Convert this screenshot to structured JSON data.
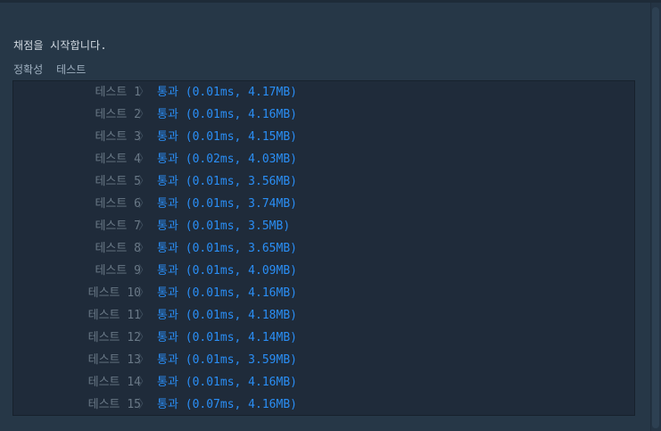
{
  "header_message": "채점을 시작합니다.",
  "section": {
    "accuracy_label": "정확성",
    "test_label": "테스트"
  },
  "tests": [
    {
      "label": "테스트 1",
      "result": "통과 (0.01ms, 4.17MB)"
    },
    {
      "label": "테스트 2",
      "result": "통과 (0.01ms, 4.16MB)"
    },
    {
      "label": "테스트 3",
      "result": "통과 (0.01ms, 4.15MB)"
    },
    {
      "label": "테스트 4",
      "result": "통과 (0.02ms, 4.03MB)"
    },
    {
      "label": "테스트 5",
      "result": "통과 (0.01ms, 3.56MB)"
    },
    {
      "label": "테스트 6",
      "result": "통과 (0.01ms, 3.74MB)"
    },
    {
      "label": "테스트 7",
      "result": "통과 (0.01ms, 3.5MB)"
    },
    {
      "label": "테스트 8",
      "result": "통과 (0.01ms, 3.65MB)"
    },
    {
      "label": "테스트 9",
      "result": "통과 (0.01ms, 4.09MB)"
    },
    {
      "label": "테스트 10",
      "result": "통과 (0.01ms, 4.16MB)"
    },
    {
      "label": "테스트 11",
      "result": "통과 (0.01ms, 4.18MB)"
    },
    {
      "label": "테스트 12",
      "result": "통과 (0.01ms, 4.14MB)"
    },
    {
      "label": "테스트 13",
      "result": "통과 (0.01ms, 3.59MB)"
    },
    {
      "label": "테스트 14",
      "result": "통과 (0.01ms, 4.16MB)"
    },
    {
      "label": "테스트 15",
      "result": "통과 (0.07ms, 4.16MB)"
    }
  ],
  "chevron_icon": "chevron-right-icon",
  "colors": {
    "background": "#263747",
    "panel": "#1f2b3a",
    "pass": "#2a8ef5",
    "label": "#6a7987"
  }
}
